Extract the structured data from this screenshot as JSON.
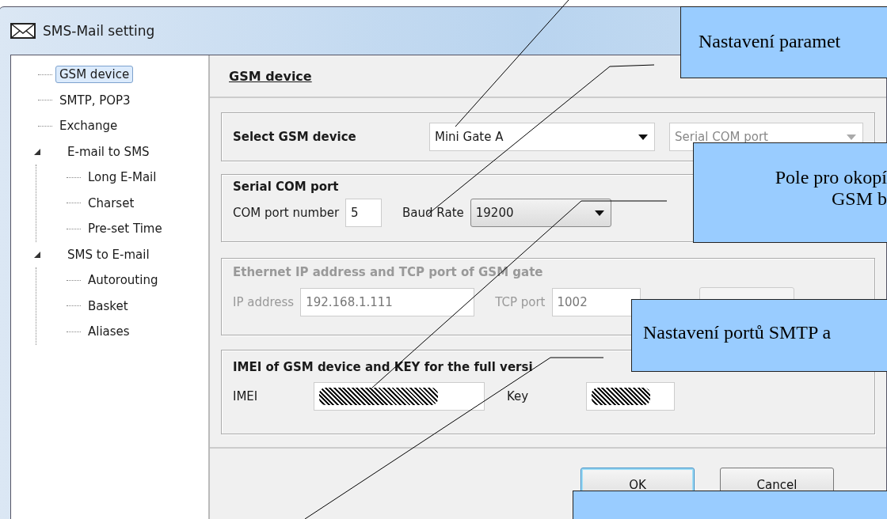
{
  "window": {
    "title": "SMS-Mail setting"
  },
  "tree": [
    {
      "label": "GSM device",
      "selected": true
    },
    {
      "label": "SMTP, POP3",
      "selected": false
    },
    {
      "label": "Exchange",
      "selected": false
    },
    {
      "label": "E-mail to SMS",
      "selected": false,
      "expanded": true,
      "children": [
        {
          "label": "Long E-Mail",
          "selected": false
        },
        {
          "label": "Charset",
          "selected": false
        },
        {
          "label": "Pre-set Time",
          "selected": false
        }
      ]
    },
    {
      "label": "SMS to E-mail",
      "selected": false,
      "expanded": true,
      "children": [
        {
          "label": "Autorouting",
          "selected": false
        },
        {
          "label": "Basket",
          "selected": false
        },
        {
          "label": "Aliases",
          "selected": false
        }
      ]
    }
  ],
  "panel": {
    "heading": "GSM device",
    "device_group": {
      "label": "Select GSM device",
      "device": "Mini Gate A",
      "connection": "Serial COM port",
      "connection_disabled": true
    },
    "serial_group": {
      "title": "Serial COM port",
      "com_label": "COM port number",
      "com_value": "5",
      "baud_label": "Baud Rate",
      "baud_value": "19200"
    },
    "ethernet_group": {
      "title": "Ethernet IP address and TCP port of GSM gate",
      "disabled": true,
      "ip_label": "IP address",
      "ip_value": "192.168.1.111",
      "port_label": "TCP port",
      "port_value": "1002"
    },
    "imei_group": {
      "title": "IMEI of GSM device and KEY for the full versi",
      "imei_label": "IMEI",
      "key_label": "Key"
    }
  },
  "buttons": [
    {
      "label": "OK",
      "default": true
    },
    {
      "label": "Cancel",
      "default": false
    }
  ],
  "callouts": [
    {
      "lines": [
        "Nastavení paramet"
      ]
    },
    {
      "lines": [
        "Pole pro okopí",
        "GSM b"
      ]
    },
    {
      "lines": [
        "Nastavení portů SMTP a"
      ]
    }
  ]
}
